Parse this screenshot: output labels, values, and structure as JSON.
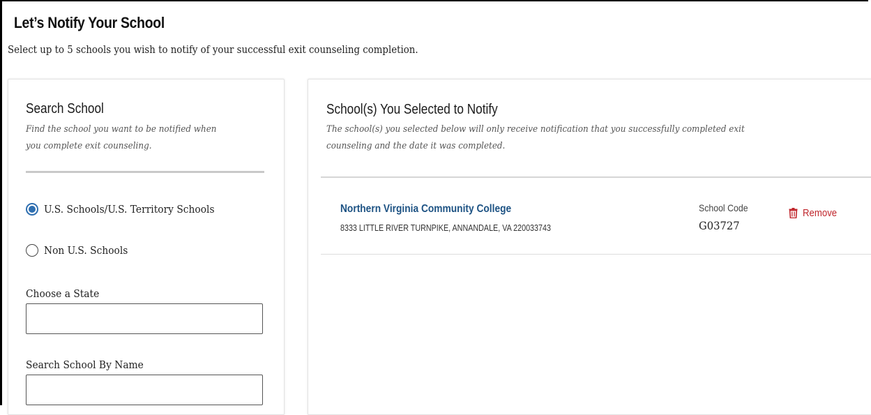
{
  "page": {
    "title": "Let’s Notify Your School",
    "subtitle": "Select up to 5 schools you wish to notify of your successful exit counseling completion."
  },
  "search_panel": {
    "heading": "Search School",
    "description_line1": "Find the school you want to be notified when",
    "description_line2": "you complete exit counseling.",
    "radio_options": [
      {
        "label": "U.S. Schools/U.S. Territory Schools",
        "selected": true
      },
      {
        "label": "Non U.S. Schools",
        "selected": false
      }
    ],
    "state_field": {
      "label": "Choose a State",
      "value": ""
    },
    "name_field": {
      "label": "Search School By Name",
      "value": ""
    }
  },
  "selected_panel": {
    "heading": "School(s) You Selected to Notify",
    "description_line1": "The school(s) you selected below will only receive notification that you successfully completed exit",
    "description_line2": "counseling and the date it was completed.",
    "schools": [
      {
        "name": "Northern Virginia Community College",
        "address": "8333 LITTLE RIVER TURNPIKE, ANNANDALE, VA 220033743",
        "code_label": "School Code",
        "code": "G03727",
        "remove_label": "Remove"
      }
    ]
  },
  "colors": {
    "link": "#1e5384",
    "remove": "#c0272d",
    "radio_selected": "#2f6fb0"
  }
}
